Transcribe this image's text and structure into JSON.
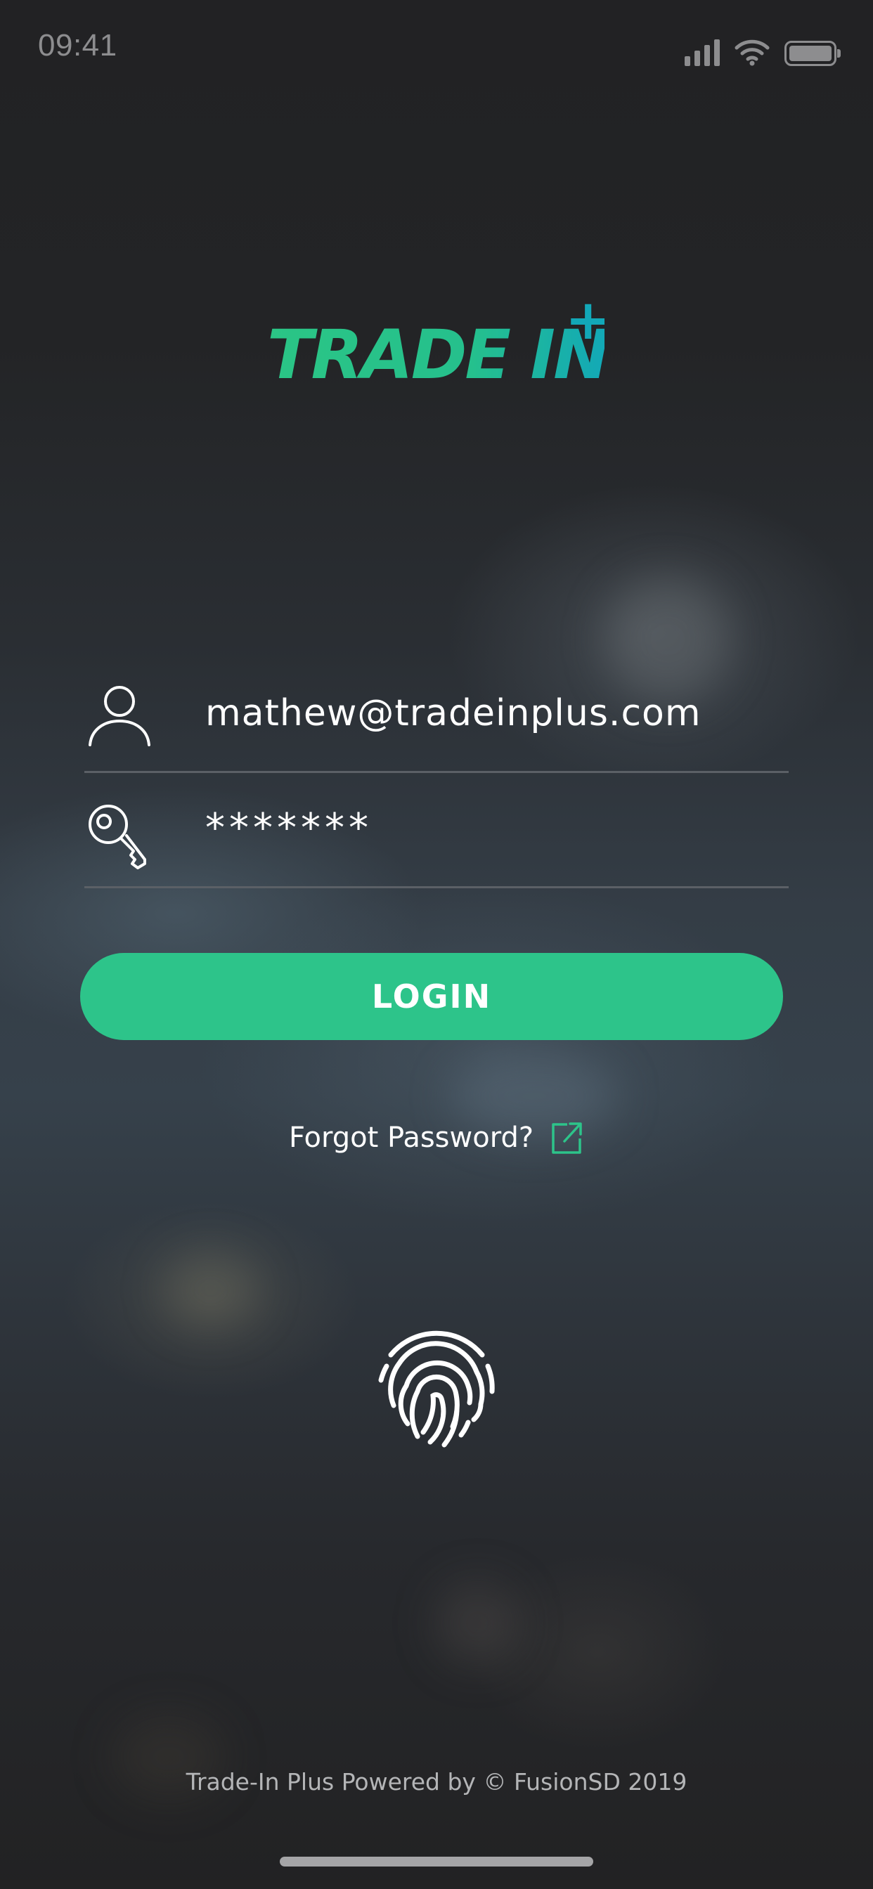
{
  "status_bar": {
    "time": "09:41",
    "icons": [
      "signal-icon",
      "wifi-icon",
      "battery-icon"
    ]
  },
  "logo": {
    "text": "TRADE IN",
    "accent_symbol": "+"
  },
  "login_form": {
    "email_value": "mathew@tradeinplus.com",
    "email_icon": "user-icon",
    "password_value": "*******",
    "password_icon": "key-icon",
    "login_label": "LOGIN",
    "forgot_label": "Forgot Password?",
    "forgot_icon": "external-link-icon",
    "biometric_icon": "fingerprint-icon"
  },
  "footer": {
    "text": "Trade-In Plus Powered by © FusionSD 2019"
  },
  "colors": {
    "accent": "#2dc48a",
    "logo_gradient_start": "#2bc585",
    "logo_gradient_end": "#12a8b8",
    "text_primary": "#ffffff",
    "text_muted": "#8d8d8f"
  }
}
